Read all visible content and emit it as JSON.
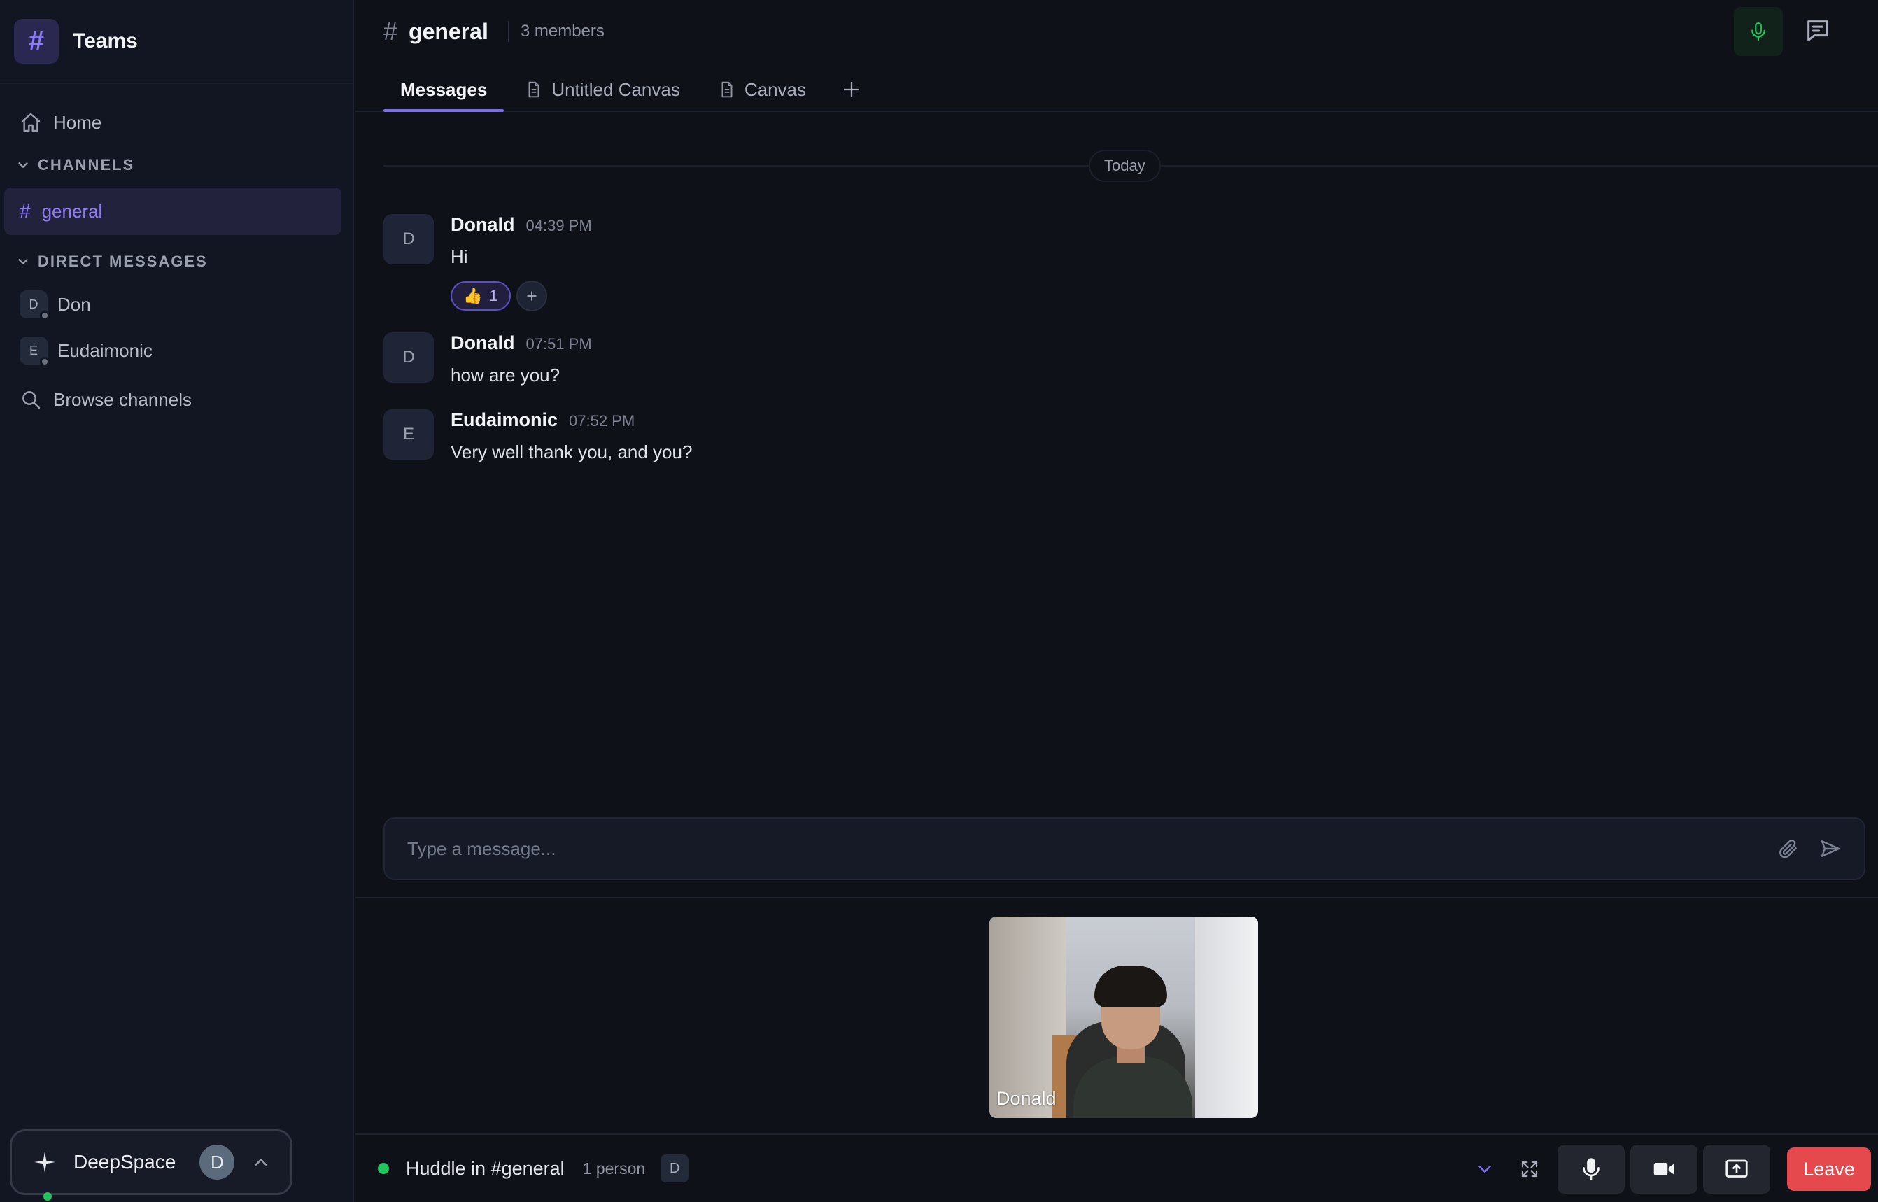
{
  "workspace": {
    "logo_glyph": "#",
    "name": "Teams"
  },
  "sidebar": {
    "home_label": "Home",
    "channels_heading": "CHANNELS",
    "channels": [
      {
        "hash": "#",
        "name": "general",
        "active": true
      }
    ],
    "dm_heading": "DIRECT MESSAGES",
    "direct_messages": [
      {
        "initial": "D",
        "name": "Don"
      },
      {
        "initial": "E",
        "name": "Eudaimonic"
      }
    ],
    "browse_label": "Browse channels"
  },
  "user_pill": {
    "name": "DeepSpace",
    "initial": "D"
  },
  "channel": {
    "hash": "#",
    "name": "general",
    "members": "3 members"
  },
  "tabs": [
    {
      "label": "Messages",
      "active": true,
      "icon": null
    },
    {
      "label": "Untitled Canvas",
      "active": false,
      "icon": "document-icon"
    },
    {
      "label": "Canvas",
      "active": false,
      "icon": "document-icon"
    }
  ],
  "date_divider": "Today",
  "messages": [
    {
      "initial": "D",
      "author": "Donald",
      "time": "04:39 PM",
      "text": "Hi",
      "reactions": [
        {
          "emoji": "👍",
          "count": "1"
        }
      ]
    },
    {
      "initial": "D",
      "author": "Donald",
      "time": "07:51 PM",
      "text": "how are you?"
    },
    {
      "initial": "E",
      "author": "Eudaimonic",
      "time": "07:52 PM",
      "text": "Very well thank you, and you?"
    }
  ],
  "composer": {
    "placeholder": "Type a message..."
  },
  "huddle": {
    "participant_name": "Donald",
    "title": "Huddle in #general",
    "count": "1 person",
    "avatar_initial": "D",
    "leave_label": "Leave"
  },
  "colors": {
    "accent": "#7c6cf0",
    "live_green": "#22c55e",
    "leave_red": "#e5484d",
    "background": "#0f1118",
    "sidebar": "#121623"
  }
}
